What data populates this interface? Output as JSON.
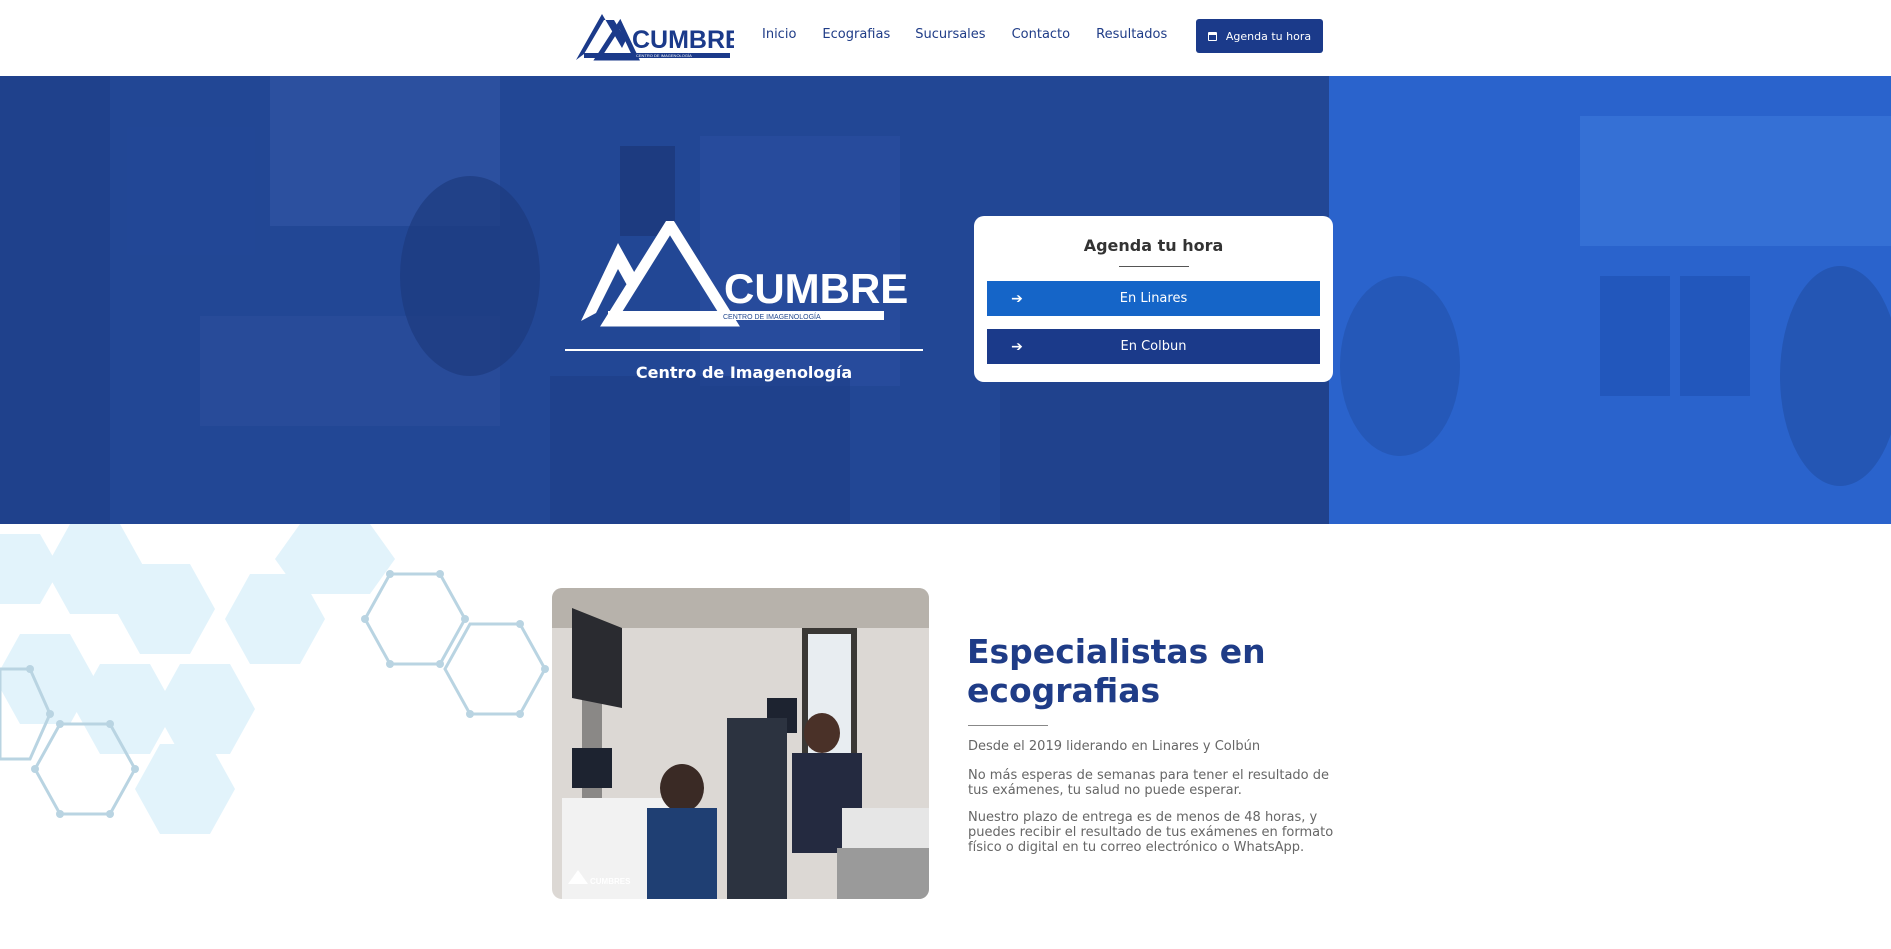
{
  "brand": {
    "name": "CUMBRES",
    "tagline": "CENTRO DE IMAGENOLOGÍA"
  },
  "nav": {
    "items": [
      "Inicio",
      "Ecografias",
      "Sucursales",
      "Contacto",
      "Resultados"
    ],
    "cta_label": "Agenda tu hora"
  },
  "hero": {
    "subtitle": "Centro de Imagenología",
    "booking": {
      "title": "Agenda tu hora",
      "buttons": [
        "En Linares",
        "En Colbun"
      ]
    }
  },
  "about": {
    "title_line1": "Especialistas en",
    "title_line2": "ecografias",
    "paragraphs": [
      "Desde el 2019 liderando en Linares y Colbún",
      "No más esperas de semanas para tener el resultado de tus exámenes, tu salud no puede esperar.",
      "Nuestro plazo de entrega es de menos de 48 horas, y puedes recibir el resultado de tus exámenes en formato físico o digital en tu correo electrónico o WhatsApp."
    ]
  },
  "colors": {
    "brand_dark_blue": "#1b3a8a",
    "button_blue": "#1565c8",
    "hero_blue": "#2a4ea4"
  },
  "icons": [
    "calendar-icon",
    "arrow-right-icon"
  ]
}
